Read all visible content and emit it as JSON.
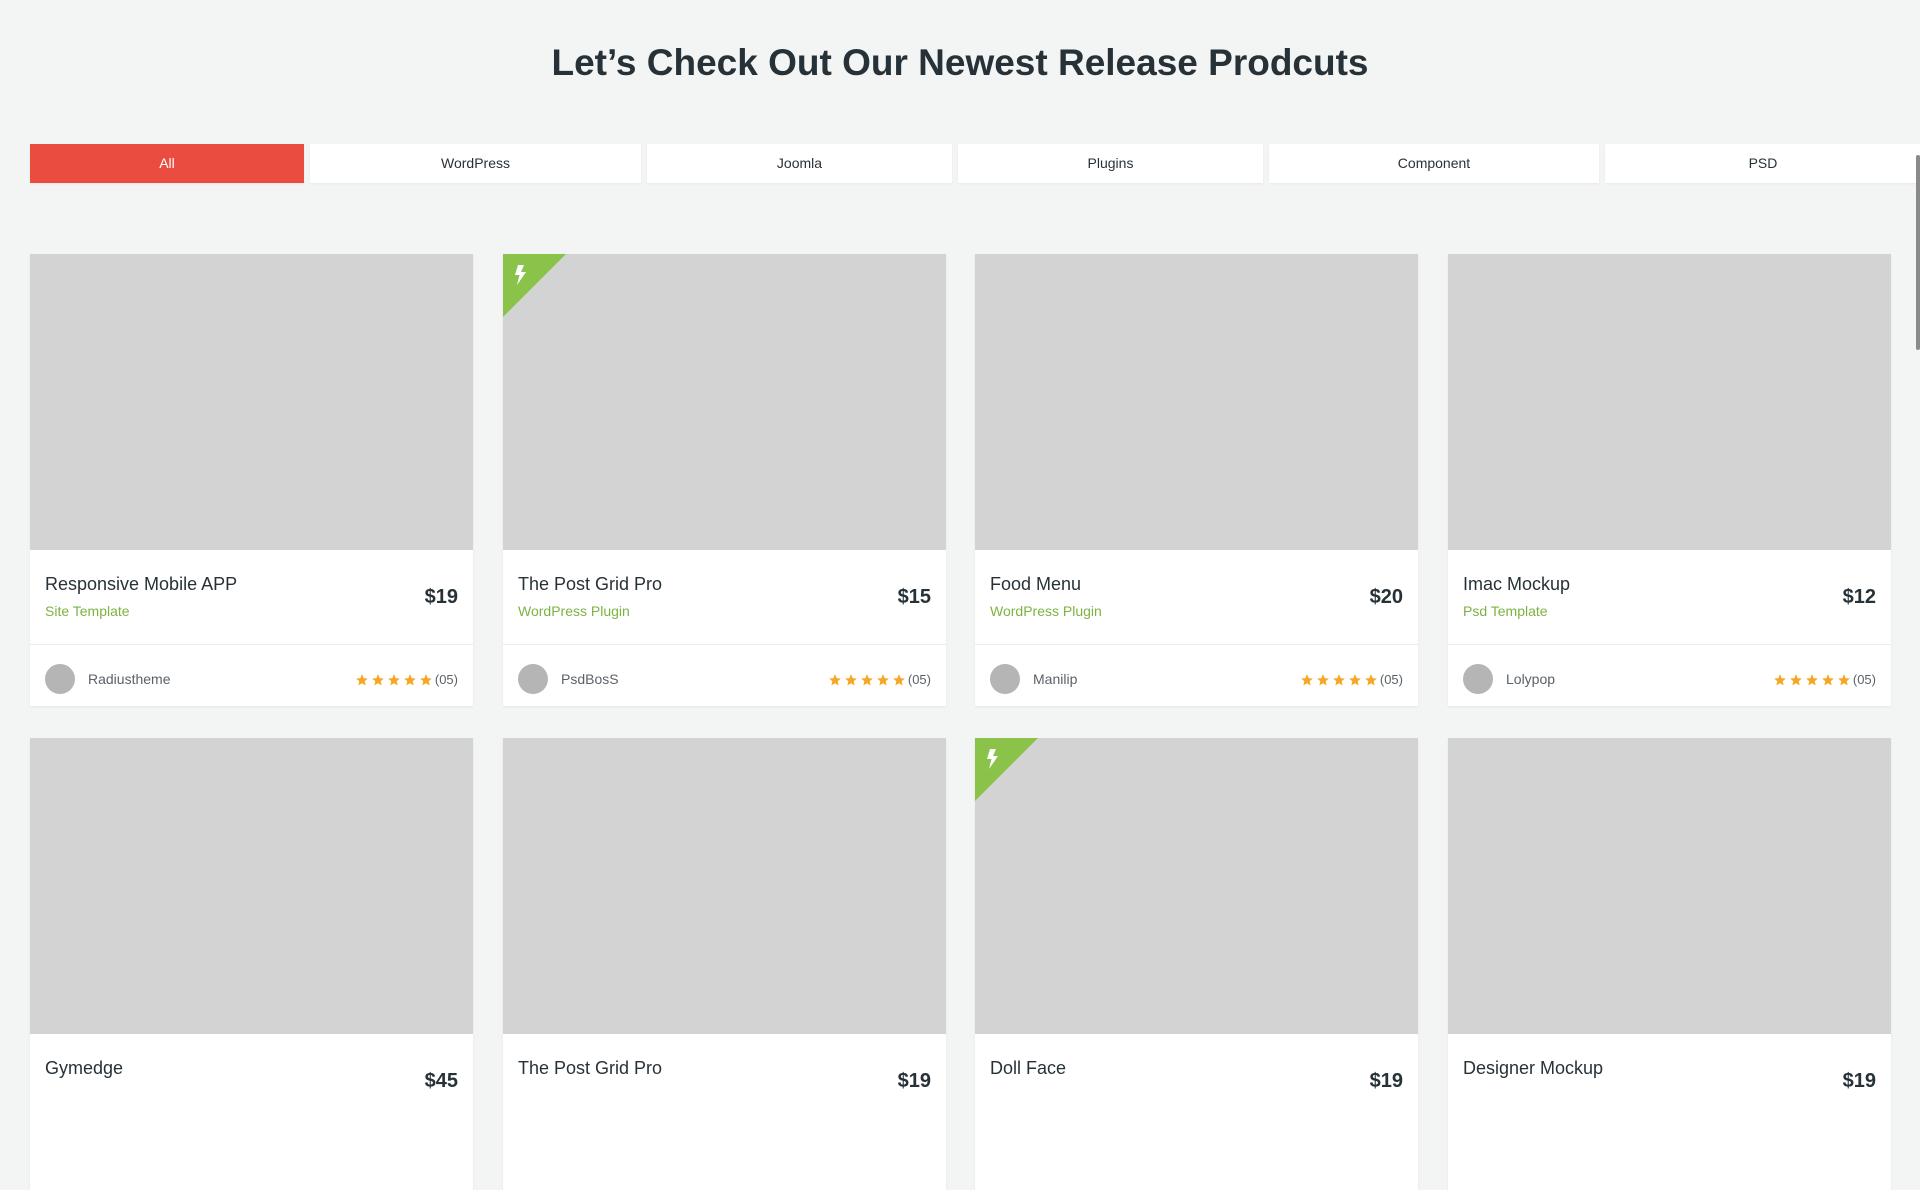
{
  "section": {
    "title": "Let’s Check Out Our Newest Release Prodcuts"
  },
  "tabs": [
    {
      "label": "All"
    },
    {
      "label": "WordPress"
    },
    {
      "label": "Joomla"
    },
    {
      "label": "Plugins"
    },
    {
      "label": "Component"
    },
    {
      "label": "PSD"
    }
  ],
  "active_tab": "All",
  "products": [
    {
      "title": "Responsive Mobile APP",
      "category": "Site Template",
      "price": "$19",
      "author": "Radiustheme",
      "rating_count": "(05)",
      "stars": 5,
      "badge": false,
      "badge_icon": ""
    },
    {
      "title": "The Post Grid Pro",
      "category": "WordPress Plugin",
      "price": "$15",
      "author": "PsdBosS",
      "rating_count": "(05)",
      "stars": 5,
      "badge": true,
      "badge_icon": "lightning-bolt-icon"
    },
    {
      "title": "Food Menu",
      "category": "WordPress Plugin",
      "price": "$20",
      "author": "Manilip",
      "rating_count": "(05)",
      "stars": 5,
      "badge": false,
      "badge_icon": ""
    },
    {
      "title": "Imac Mockup",
      "category": "Psd Template",
      "price": "$12",
      "author": "Lolypop",
      "rating_count": "(05)",
      "stars": 5,
      "badge": false,
      "badge_icon": ""
    },
    {
      "title": "Gymedge",
      "category": "",
      "price": "$45",
      "author": "",
      "rating_count": "",
      "stars": 0,
      "badge": false,
      "badge_icon": ""
    },
    {
      "title": "The Post Grid Pro",
      "category": "",
      "price": "$19",
      "author": "",
      "rating_count": "",
      "stars": 0,
      "badge": false,
      "badge_icon": ""
    },
    {
      "title": "Doll Face",
      "category": "",
      "price": "$19",
      "author": "",
      "rating_count": "",
      "stars": 0,
      "badge": true,
      "badge_icon": "lightning-bolt-icon"
    },
    {
      "title": "Designer Mockup",
      "category": "",
      "price": "$19",
      "author": "",
      "rating_count": "",
      "stars": 0,
      "badge": false,
      "badge_icon": ""
    }
  ],
  "colors": {
    "accent": "#ea4c3f",
    "badge": "#8bc34a",
    "category": "#7cb342",
    "star": "#f5a623",
    "image_placeholder": "#d3d3d3",
    "background": "#f3f4f4"
  }
}
